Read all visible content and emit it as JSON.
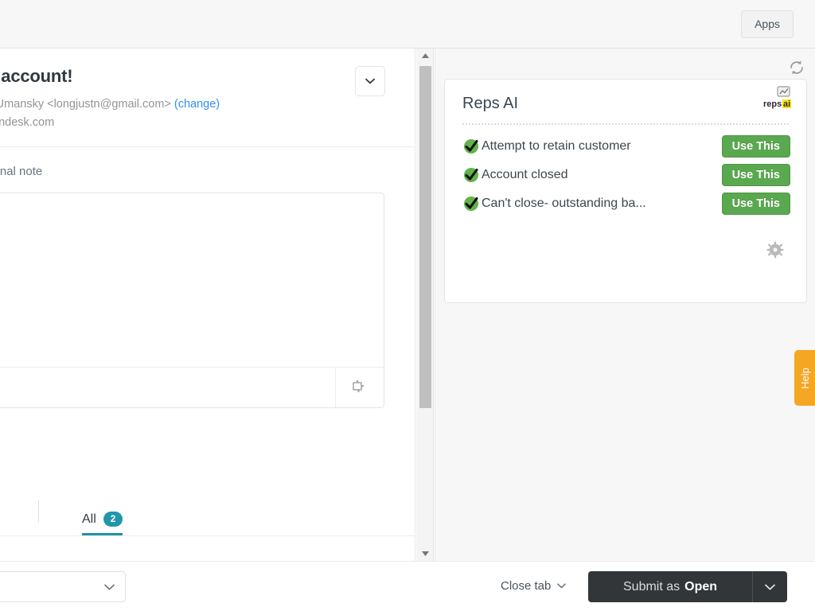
{
  "topbar": {
    "apps_button": "Apps"
  },
  "ticket": {
    "subject": "se my account!",
    "requester_line": "Mike Umansky <longjustn@gmail.com>",
    "change_link": "(change)",
    "domain_line": "ikereps.zendesk.com",
    "collapse_icon": "chevron-down-icon"
  },
  "composer": {
    "channel_label": "nternal note",
    "editor_value": "",
    "editor_placeholder": "",
    "toolbar_icon": "apps-puzzle-icon"
  },
  "tabs": {
    "items": [
      {
        "label": "All",
        "badge": "2",
        "active": true
      }
    ]
  },
  "scrollbar": {
    "up_icon": "scroll-up-arrow-icon",
    "down_icon": "scroll-down-arrow-icon"
  },
  "apps_panel": {
    "refresh_icon": "refresh-icon",
    "card": {
      "title": "Reps AI",
      "logo_text": "reps",
      "logo_accent": "ai",
      "gear_icon": "gear-icon",
      "suggestions": [
        {
          "icon": "green-check-icon",
          "text": "Attempt to retain customer",
          "action": "Use This"
        },
        {
          "icon": "green-check-icon",
          "text": "Account closed",
          "action": "Use This"
        },
        {
          "icon": "green-check-icon",
          "text": "Can't close- outstanding ba...",
          "action": "Use This"
        }
      ]
    }
  },
  "help_tab": {
    "label": "Help"
  },
  "bottombar": {
    "macro_select_value": "",
    "macro_caret_icon": "chevron-down-icon",
    "close_tab_label": "Close tab",
    "close_tab_icon": "chevron-down-icon",
    "submit_prefix": "Submit as",
    "submit_status": "Open",
    "submit_caret_icon": "chevron-down-icon"
  },
  "colors": {
    "accent_teal": "#2196ab",
    "green": "#5aa84f",
    "link_blue": "#3091ec",
    "help_orange": "#f5a623",
    "submit_dark": "#333638"
  }
}
